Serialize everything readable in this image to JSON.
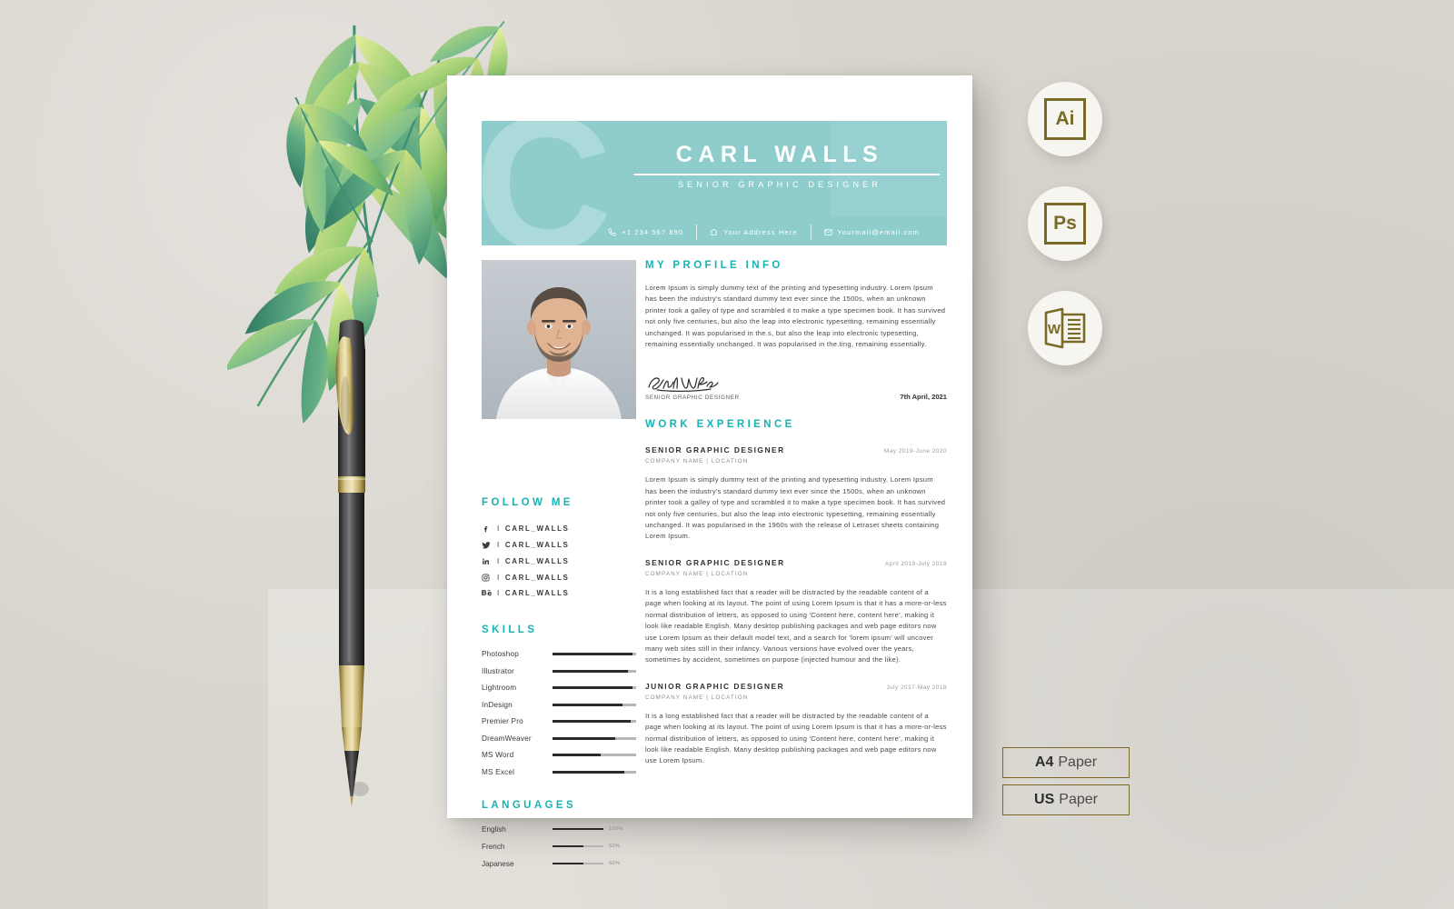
{
  "scene": {
    "background_color": "#d9d5ce",
    "lower_panel_color": "#e3e0da"
  },
  "resume": {
    "accent_color": "#17b3b3",
    "header_band_color": "#8fcdcd",
    "header": {
      "monogram": "C",
      "name": "CARL WALLS",
      "role": "SENIOR GRAPHIC DESIGNER",
      "contacts": [
        {
          "icon": "phone-icon",
          "text": "+1 234 567 890"
        },
        {
          "icon": "home-icon",
          "text": "Your Address Here"
        },
        {
          "icon": "envelope-icon",
          "text": "Yourmail@email.com"
        }
      ]
    },
    "profile": {
      "title": "MY PROFILE INFO",
      "text": "Lorem Ipsum is simply dummy text of the printing and typesetting industry. Lorem Ipsum has been the industry's standard dummy text ever since the 1500s, when an unknown printer took a galley of type and scrambled it to make a type specimen book. It has survived not only five centuries, but also the leap into electronic typesetting, remaining essentially unchanged. It was popularised in the.s, but also the leap into electronic typesetting, remaining essentially unchanged. It was popularised in the.ting, remaining essentially.",
      "signature_name": "Carl Walls",
      "signature_role": "SENIOR GRAPHIC DESIGNER",
      "date": "7th April, 2021"
    },
    "follow_me": {
      "title": "FOLLOW ME",
      "items": [
        {
          "icon": "facebook-icon",
          "handle": "CARL_WALLS"
        },
        {
          "icon": "twitter-icon",
          "handle": "CARL_WALLS"
        },
        {
          "icon": "linkedin-icon",
          "handle": "CARL_WALLS"
        },
        {
          "icon": "instagram-icon",
          "handle": "CARL_WALLS"
        },
        {
          "icon": "behance-icon",
          "handle": "CARL_WALLS"
        }
      ],
      "separator": "I"
    },
    "skills": {
      "title": "SKILLS",
      "items": [
        {
          "name": "Photoshop",
          "value": 96
        },
        {
          "name": "Illustrator",
          "value": 90
        },
        {
          "name": "Lightroom",
          "value": 96
        },
        {
          "name": "InDesign",
          "value": 84
        },
        {
          "name": "Premier Pro",
          "value": 93
        },
        {
          "name": "DreamWeaver",
          "value": 75
        },
        {
          "name": "MS Word",
          "value": 58
        },
        {
          "name": "MS Excel",
          "value": 86
        }
      ]
    },
    "languages": {
      "title": "LANGUAGES",
      "items": [
        {
          "name": "English",
          "value": 100,
          "label": "100%"
        },
        {
          "name": "French",
          "value": 60,
          "label": "60%"
        },
        {
          "name": "Japanese",
          "value": 60,
          "label": "60%"
        }
      ]
    },
    "work_experience": {
      "title": "WORK EXPERIENCE",
      "jobs": [
        {
          "title": "SENIOR GRAPHIC DESIGNER",
          "date": "May 2019-June 2020",
          "meta": "COMPANY NAME  |  LOCATION",
          "body": "Lorem Ipsum is simply dummy text of the printing and typesetting industry. Lorem Ipsum has been the industry's standard dummy text ever since the 1500s, when an unknown printer took a galley of type and scrambled it to make a type specimen book. It has survived not only five centuries, but also the leap into electronic typesetting, remaining essentially unchanged. It was popularised in the 1960s with the release of Letraset sheets containing Lorem Ipsum."
        },
        {
          "title": "SENIOR GRAPHIC DESIGNER",
          "date": "April 2018-July 2019",
          "meta": "COMPANY NAME  |  LOCATION",
          "body": "It is a long established fact that a reader will be distracted by the readable content of a page when looking at its layout. The point of using Lorem Ipsum is that it has a more-or-less normal distribution of letters, as opposed to using 'Content here, content here', making it look like readable English. Many desktop publishing packages and web page editors now use Lorem Ipsum as their default model text, and a search for 'lorem ipsum' will uncover many web sites still in their infancy. Various versions have evolved over the years, sometimes by accident, sometimes on purpose (injected humour and the like)."
        },
        {
          "title": "JUNIOR GRAPHIC DESIGNER",
          "date": "July 2017-May 2018",
          "meta": "COMPANY NAME  |  LOCATION",
          "body": "It is a long established fact that a reader will be distracted by the readable content of a page when looking at its layout. The point of using Lorem Ipsum is that it has a more-or-less normal distribution of letters, as opposed to using 'Content here, content here', making it look like readable English. Many desktop publishing packages and web page editors now use Lorem Ipsum."
        }
      ]
    }
  },
  "format_badges": {
    "color": "#7a6a28",
    "items": [
      {
        "icon": "illustrator-icon",
        "label": "Ai"
      },
      {
        "icon": "photoshop-icon",
        "label": "Ps"
      },
      {
        "icon": "word-icon",
        "label": "W"
      }
    ]
  },
  "paper_sizes": [
    {
      "size": "A4",
      "unit": "Paper"
    },
    {
      "size": "US",
      "unit": "Paper"
    }
  ]
}
